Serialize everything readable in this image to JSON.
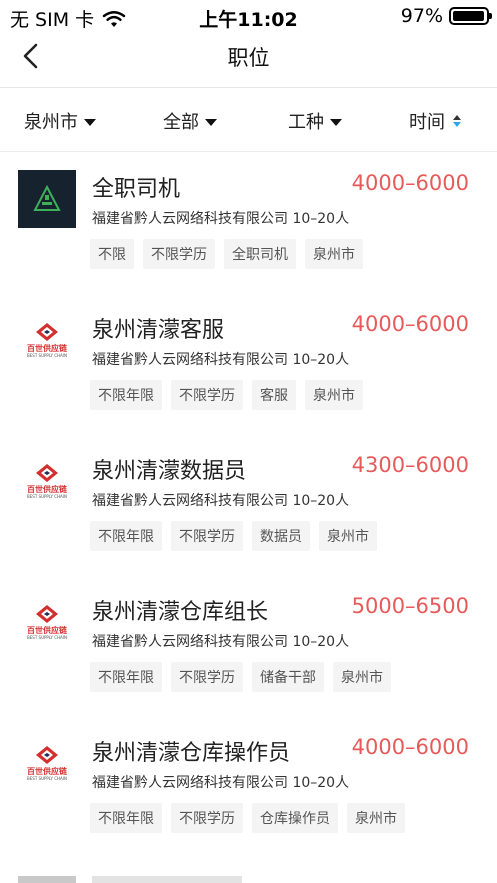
{
  "status_bar": {
    "carrier": "无 SIM 卡",
    "time": "上午11:02",
    "battery_text": "97%",
    "battery_level": 0.97
  },
  "nav": {
    "title": "职位",
    "back_icon": "chevron-left-icon"
  },
  "filters": [
    {
      "label": "泉州市",
      "icon": "caret-down-icon"
    },
    {
      "label": "全部",
      "icon": "caret-down-icon"
    },
    {
      "label": "工种",
      "icon": "caret-down-icon"
    },
    {
      "label": "时间",
      "icon": "sort-icon"
    }
  ],
  "colors": {
    "salary": "#e85a5a",
    "sort_active": "#2aa7e8",
    "brand_red": "#d32f2f"
  },
  "jobs": [
    {
      "title": "全职司机",
      "salary": "4000–6000",
      "company": "福建省黔人云网络科技有限公司 10–20人",
      "tags": [
        "不限",
        "不限学历",
        "全职司机",
        "泉州市"
      ]
    },
    {
      "title": "泉州清濛客服",
      "salary": "4000–6000",
      "company": "福建省黔人云网络科技有限公司 10–20人",
      "tags": [
        "不限年限",
        "不限学历",
        "客服",
        "泉州市"
      ]
    },
    {
      "title": "泉州清濛数据员",
      "salary": "4300–6000",
      "company": "福建省黔人云网络科技有限公司 10–20人",
      "tags": [
        "不限年限",
        "不限学历",
        "数据员",
        "泉州市"
      ]
    },
    {
      "title": "泉州清濛仓库组长",
      "salary": "5000–6500",
      "company": "福建省黔人云网络科技有限公司 10–20人",
      "tags": [
        "不限年限",
        "不限学历",
        "储备干部",
        "泉州市"
      ]
    },
    {
      "title": "泉州清濛仓库操作员",
      "salary": "4000–6000",
      "company": "福建省黔人云网络科技有限公司 10–20人",
      "tags": [
        "不限年限",
        "不限学历",
        "仓库操作员",
        "泉州市"
      ]
    }
  ],
  "logos": {
    "supply_chain_caption": "百世供应链",
    "supply_chain_sub": "BEST SUPPLY CHAIN"
  }
}
